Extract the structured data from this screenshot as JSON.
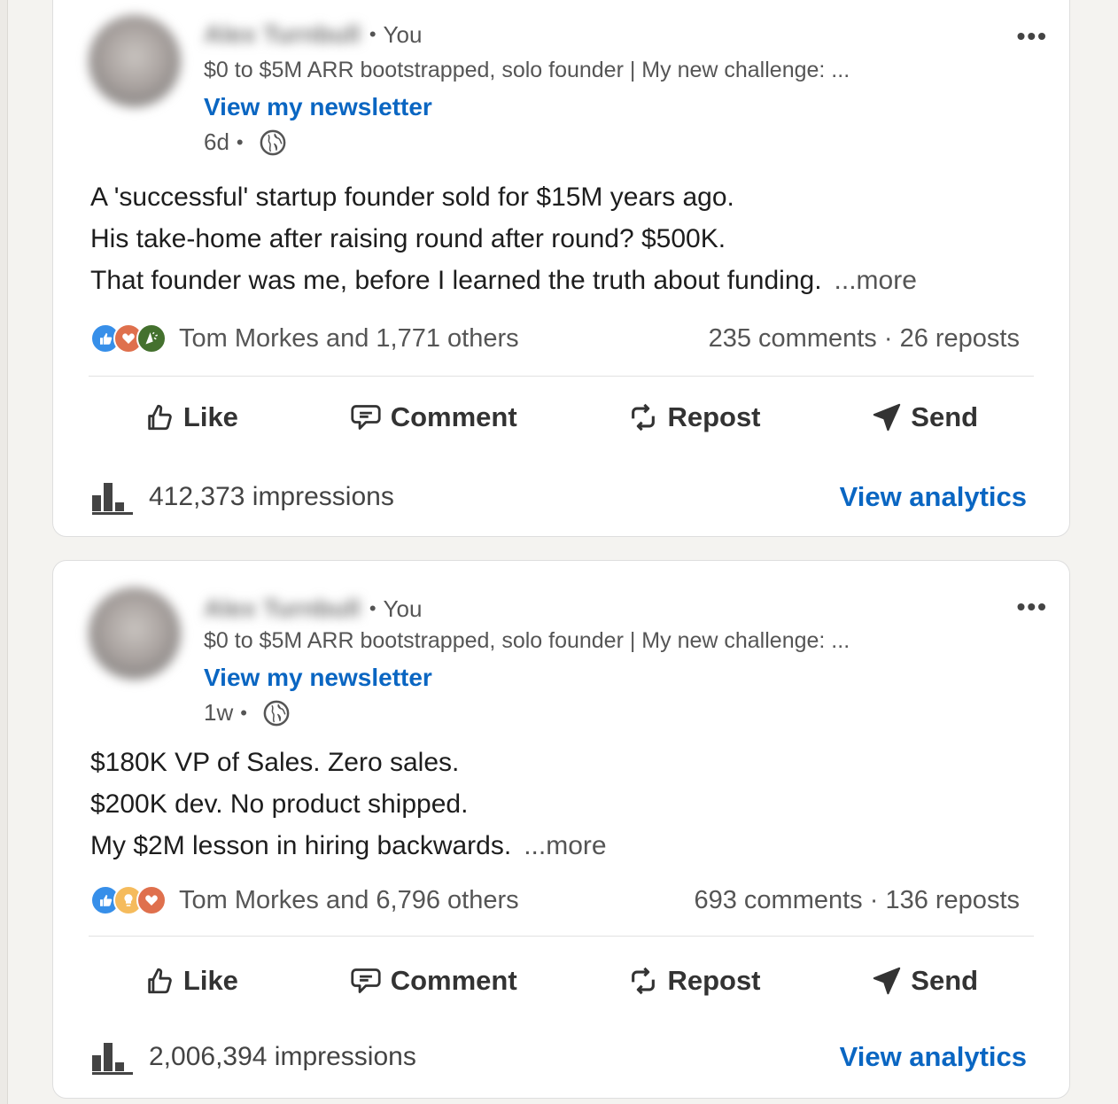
{
  "posts": [
    {
      "author_name": "Alex Turnbull",
      "relation": "You",
      "headline": "$0 to $5M ARR bootstrapped, solo founder | My new challenge: ...",
      "newsletter_link": "View my newsletter",
      "time": "6d",
      "body_lines": [
        "A 'successful' startup founder sold for $15M years ago.",
        "His take-home after raising round after round? $500K.",
        "That founder was me, before I learned the truth about funding."
      ],
      "more": "...more",
      "reactions_text": "Tom Morkes and 1,771 others",
      "reaction_icons": [
        "like-icon",
        "love-icon",
        "celebrate-icon"
      ],
      "comments": "235 comments",
      "reposts": "26 reposts",
      "actions": {
        "like": "Like",
        "comment": "Comment",
        "repost": "Repost",
        "send": "Send"
      },
      "impressions": "412,373 impressions",
      "view_analytics": "View analytics"
    },
    {
      "author_name": "Alex Turnbull",
      "relation": "You",
      "headline": "$0 to $5M ARR bootstrapped, solo founder | My new challenge: ...",
      "newsletter_link": "View my newsletter",
      "time": "1w",
      "body_lines": [
        "$180K VP of Sales. Zero sales.",
        "$200K dev. No product shipped.",
        "My $2M lesson in hiring backwards."
      ],
      "more": "...more",
      "reactions_text": "Tom Morkes and 6,796 others",
      "reaction_icons": [
        "like-icon",
        "insightful-icon",
        "love-icon"
      ],
      "comments": "693 comments",
      "reposts": "136 reposts",
      "actions": {
        "like": "Like",
        "comment": "Comment",
        "repost": "Repost",
        "send": "Send"
      },
      "impressions": "2,006,394 impressions",
      "view_analytics": "View analytics"
    }
  ],
  "colors": {
    "link": "#0a66c2",
    "like": "#378fe9",
    "love": "#df704d",
    "celebrate": "#44712e",
    "insightful": "#f5bb5c"
  }
}
